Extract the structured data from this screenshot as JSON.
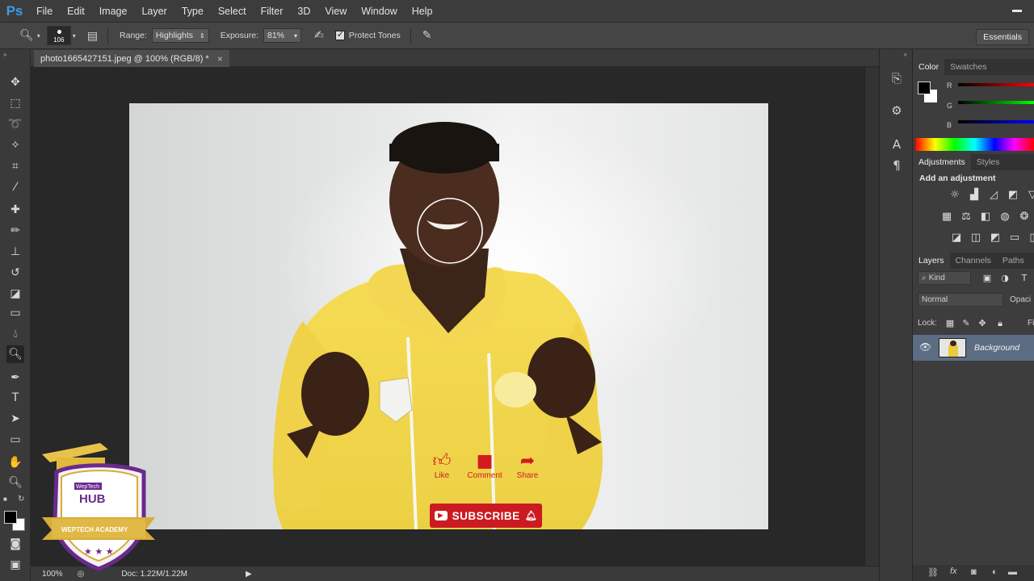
{
  "app": {
    "logo": "Ps"
  },
  "menu": [
    "File",
    "Edit",
    "Image",
    "Layer",
    "Type",
    "Select",
    "Filter",
    "3D",
    "View",
    "Window",
    "Help"
  ],
  "options": {
    "brush_size": "106",
    "range_label": "Range:",
    "range_value": "Highlights",
    "exposure_label": "Exposure:",
    "exposure_value": "81%",
    "protect_tones_label": "Protect Tones",
    "protect_tones_checked": true,
    "workspace": "Essentials"
  },
  "document": {
    "tab_title": "photo1665427151.jpeg @ 100% (RGB/8) *",
    "close_glyph": "×"
  },
  "status": {
    "zoom": "100%",
    "doc_info": "Doc: 1.22M/1.22M"
  },
  "color_panel": {
    "tabs": [
      "Color",
      "Swatches"
    ],
    "channels": [
      "R",
      "G",
      "B"
    ],
    "foreground": "#000000",
    "background": "#ffffff"
  },
  "adjustments_panel": {
    "tabs": [
      "Adjustments",
      "Styles"
    ],
    "heading": "Add an adjustment"
  },
  "layers_panel": {
    "tabs": [
      "Layers",
      "Channels",
      "Paths"
    ],
    "filter_kind": "Kind",
    "blend_mode": "Normal",
    "opacity_label": "Opaci",
    "lock_label": "Lock:",
    "fill_label": "Fi",
    "layers": [
      {
        "name": "Background",
        "visible": true
      }
    ]
  },
  "overlay": {
    "like": "Like",
    "comment": "Comment",
    "share": "Share",
    "subscribe": "SUBSCRIBE",
    "badge_lines": [
      "WepTech",
      "HUB",
      "WEPTECH ACADEMY"
    ]
  },
  "colors": {
    "accent_red": "#cc1a22",
    "ps_blue": "#3c9ce5",
    "shirt_yellow": "#f2d64a",
    "badge_purple": "#6a2a8c",
    "badge_gold": "#d8ac3a"
  }
}
